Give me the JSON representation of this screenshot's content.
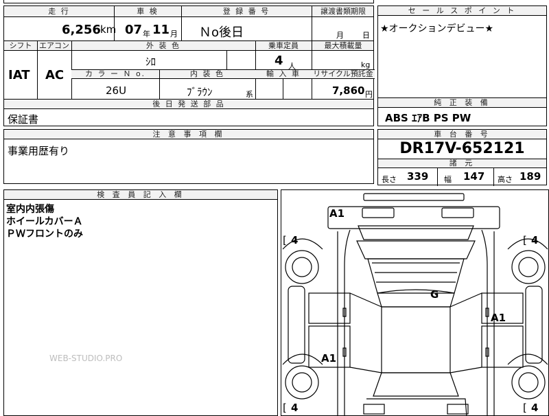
{
  "top_left": {
    "mileage_label": "走 行",
    "mileage_value": "6,256",
    "mileage_unit": "km",
    "inspection_label": "車 検",
    "inspection_year": "07",
    "inspection_year_unit": "年",
    "inspection_month": "11",
    "inspection_month_unit": "月",
    "registration_label": "登 録 番 号",
    "registration_value": "Ｎo後日",
    "transfer_label": "譲渡書類期限",
    "transfer_month_unit": "月",
    "transfer_day_unit": "日"
  },
  "row2": {
    "shift_label": "シフト",
    "aircon_label": "エアコン",
    "exterior_label": "外 装 色",
    "capacity_label": "乗車定員",
    "maxload_label": "最大積載量",
    "shift_value": "IAT",
    "aircon_value": "AC",
    "exterior_value": "ｼﾛ",
    "capacity_value": "4",
    "capacity_unit": "人",
    "maxload_unit": "kg",
    "color_no_label": "カ ラ ー Ｎ o.",
    "interior_label": "内 装 色",
    "import_label": "輸 入 車",
    "recycle_label": "リサイクル預託金",
    "color_no_value": "26U",
    "interior_value": "ﾌﾞﾗｳﾝ",
    "interior_suffix": "系",
    "recycle_value": "7,860",
    "recycle_unit": "円"
  },
  "later_parts": {
    "label": "後 日 発 送 部 品",
    "value": "保証書"
  },
  "caution": {
    "label": "注 意 事 項 欄",
    "value": "事業用歴有り"
  },
  "sales_point": {
    "label": "セ ー ル ス ポ イ ン ト",
    "value": "★オークションデビュー★"
  },
  "equipment": {
    "label": "純 正 装 備",
    "value": "ABS ｴｱB PS PW"
  },
  "chassis": {
    "label": "車 台 番 号",
    "value": "DR17V-652121"
  },
  "specs": {
    "label": "諸 元",
    "length_label": "長さ",
    "length_value": "339",
    "width_label": "幅",
    "width_value": "147",
    "height_label": "高さ",
    "height_value": "189"
  },
  "inspector": {
    "label": "検 査 員 記 入 欄",
    "lines": [
      "室内内張傷",
      "ホイールカバーＡ",
      "ＰＷフロントのみ"
    ]
  },
  "watermark": "WEB-STUDIO.PRO",
  "diagram": {
    "tl_open": "[",
    "tl_value": "4",
    "tr_open": "[",
    "tr_value": "4",
    "bl_open": "[",
    "bl_value": "4",
    "br_open": "[",
    "br_value": "4",
    "mark_front": "A1",
    "mark_roof": "G",
    "mark_right": "A1",
    "mark_left": "A1"
  }
}
